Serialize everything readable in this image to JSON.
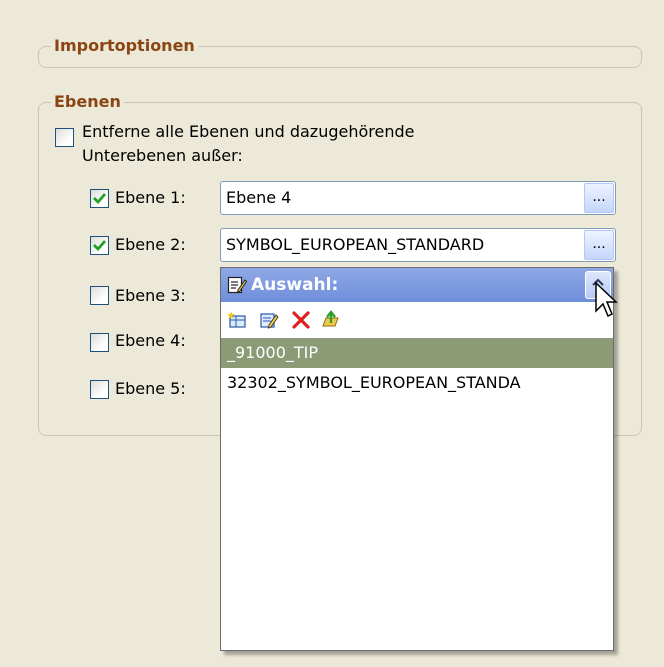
{
  "import_group": {
    "title": "Importoptionen"
  },
  "layers_group": {
    "title": "Ebenen",
    "remove_all": {
      "checked": false,
      "label": "Entferne alle Ebenen und dazugehörende Unterebenen außer:"
    },
    "rows": [
      {
        "checked": true,
        "label": "Ebene 1:",
        "value": "Ebene 4"
      },
      {
        "checked": true,
        "label": "Ebene 2:",
        "value": "SYMBOL_EUROPEAN_STANDARD"
      },
      {
        "checked": false,
        "label": "Ebene 3:"
      },
      {
        "checked": false,
        "label": "Ebene 4:"
      },
      {
        "checked": false,
        "label": "Ebene 5:"
      }
    ],
    "browse_label": "..."
  },
  "popup": {
    "title": "Auswahl:",
    "toolbar": [
      "new-entry-icon",
      "edit-entry-icon",
      "delete-icon",
      "import-icon"
    ],
    "items": [
      {
        "text": "_91000_TIP",
        "selected": true
      },
      {
        "text": "32302_SYMBOL_EUROPEAN_STANDA",
        "selected": false
      }
    ]
  },
  "colors": {
    "window_bg": "#ece9d8",
    "group_title": "#8b4513",
    "popup_header": "#7b97df",
    "selected_item": "#8c9b76",
    "check_green": "#21a121",
    "delete_red": "#e02020"
  }
}
